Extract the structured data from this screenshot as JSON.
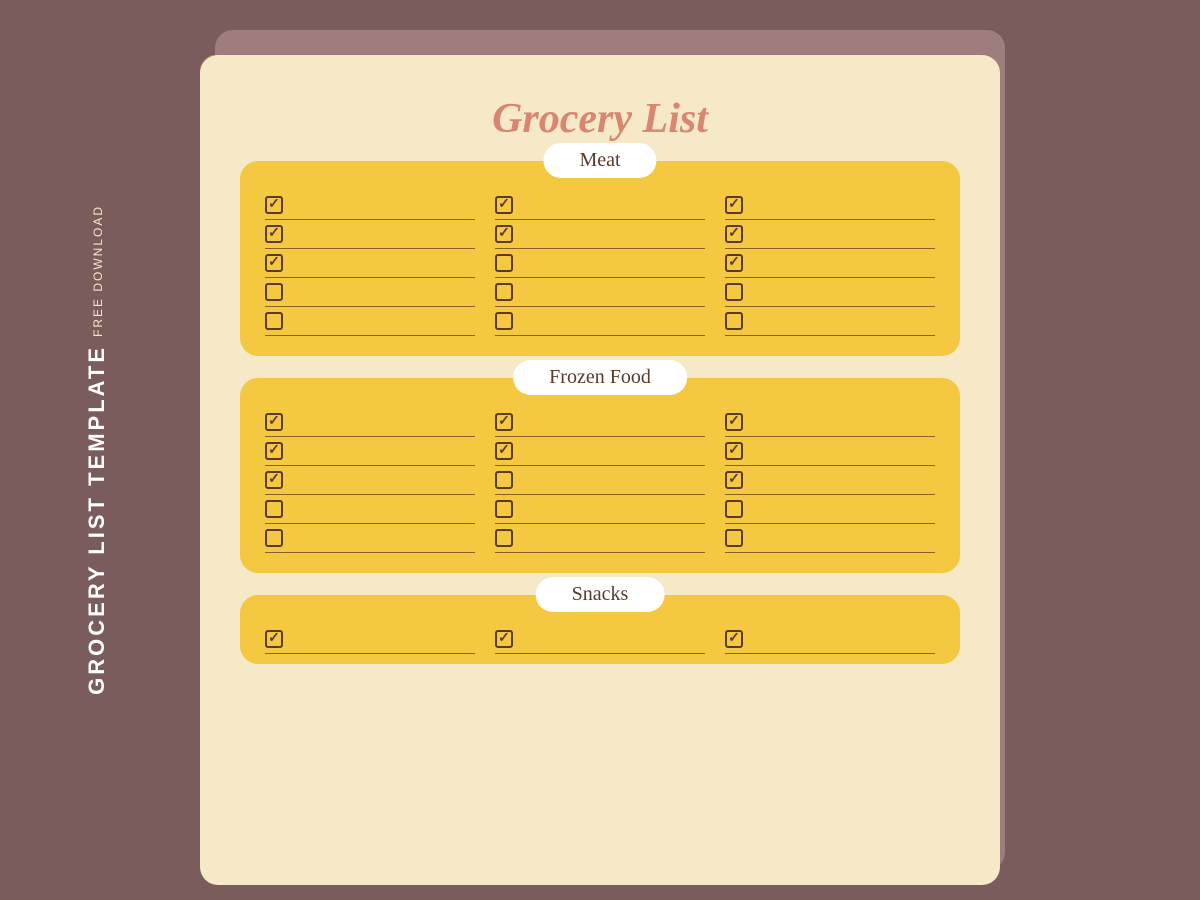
{
  "sidebar": {
    "free_label": "FREE DOWNLOAD",
    "main_label": "GROCERY LIST TEMPLATE"
  },
  "page": {
    "title": "Grocery List"
  },
  "sections": [
    {
      "id": "meat",
      "label": "Meat",
      "items": [
        {
          "checked": true
        },
        {
          "checked": true
        },
        {
          "checked": true
        },
        {
          "checked": true
        },
        {
          "checked": true
        },
        {
          "checked": true
        },
        {
          "checked": true
        },
        {
          "checked": false
        },
        {
          "checked": true
        },
        {
          "checked": false
        },
        {
          "checked": false
        },
        {
          "checked": false
        },
        {
          "checked": false
        },
        {
          "checked": false
        },
        {
          "checked": false
        }
      ]
    },
    {
      "id": "frozen-food",
      "label": "Frozen Food",
      "items": [
        {
          "checked": true
        },
        {
          "checked": true
        },
        {
          "checked": true
        },
        {
          "checked": true
        },
        {
          "checked": true
        },
        {
          "checked": true
        },
        {
          "checked": true
        },
        {
          "checked": false
        },
        {
          "checked": true
        },
        {
          "checked": false
        },
        {
          "checked": false
        },
        {
          "checked": false
        },
        {
          "checked": false
        },
        {
          "checked": false
        },
        {
          "checked": false
        }
      ]
    },
    {
      "id": "snacks",
      "label": "Snacks",
      "items": [
        {
          "checked": true
        },
        {
          "checked": true
        },
        {
          "checked": true
        }
      ]
    }
  ],
  "colors": {
    "background": "#7a5c5c",
    "paper": "#f5e9c8",
    "section_bg": "#f5c842",
    "accent": "#c97b6b",
    "title": "#d98570",
    "text_dark": "#5a3a2a"
  }
}
